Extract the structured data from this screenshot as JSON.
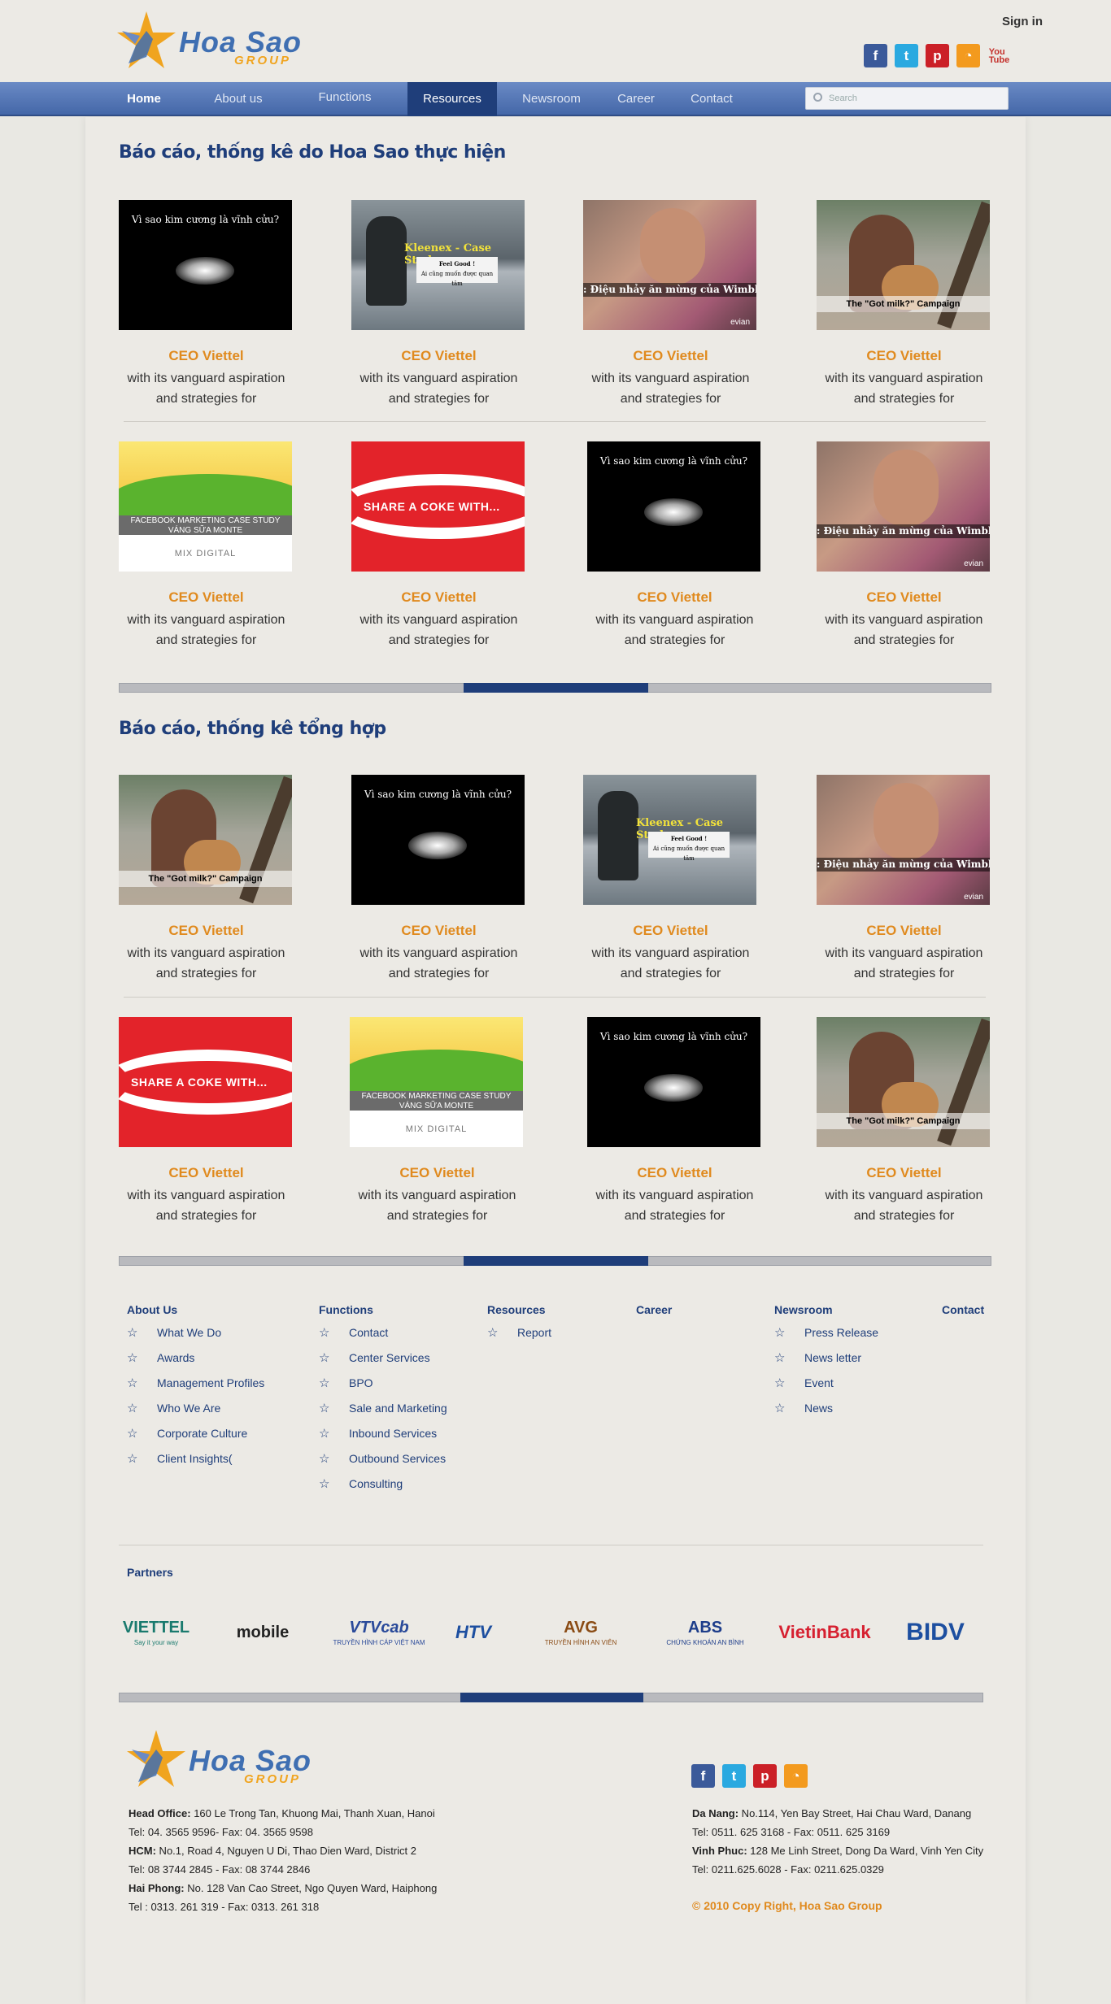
{
  "header": {
    "logo_text": "Hoa Sao",
    "logo_sub": "GROUP",
    "signin": "Sign in",
    "socials": [
      "facebook-icon",
      "twitter-icon",
      "pinterest-icon",
      "rss-icon",
      "youtube-icon"
    ]
  },
  "nav": {
    "items": [
      "Home",
      "About us",
      "Functions",
      "Resources",
      "Newsroom",
      "Career",
      "Contact"
    ],
    "active": "Resources",
    "search_placeholder": "Search"
  },
  "section1": {
    "title": "Báo cáo, thống kê do Hoa Sao thực hiện",
    "cards": [
      {
        "thumb": "diamond",
        "title": "CEO Viettel",
        "desc1": "with its vanguard aspiration",
        "desc2": "and strategies for"
      },
      {
        "thumb": "rain",
        "title": "CEO Viettel",
        "desc1": "with its vanguard aspiration",
        "desc2": "and strategies for"
      },
      {
        "thumb": "girl",
        "title": "CEO Viettel",
        "desc1": "with its vanguard aspiration",
        "desc2": "and strategies for"
      },
      {
        "thumb": "milk",
        "title": "CEO Viettel",
        "desc1": "with its vanguard aspiration",
        "desc2": "and strategies for"
      },
      {
        "thumb": "fb",
        "title": "CEO Viettel",
        "desc1": "with its vanguard aspiration",
        "desc2": "and strategies for"
      },
      {
        "thumb": "coke",
        "title": "CEO Viettel",
        "desc1": "with its vanguard aspiration",
        "desc2": "and strategies for"
      },
      {
        "thumb": "diamond",
        "title": "CEO Viettel",
        "desc1": "with its vanguard aspiration",
        "desc2": "and strategies for"
      },
      {
        "thumb": "girl",
        "title": "CEO Viettel",
        "desc1": "with its vanguard aspiration",
        "desc2": "and strategies for"
      }
    ]
  },
  "section2": {
    "title": "Báo cáo, thống kê tổng hợp",
    "cards": [
      {
        "thumb": "milk",
        "title": "CEO Viettel",
        "desc1": "with its vanguard aspiration",
        "desc2": "and strategies for"
      },
      {
        "thumb": "diamond",
        "title": "CEO Viettel",
        "desc1": "with its vanguard aspiration",
        "desc2": "and strategies for"
      },
      {
        "thumb": "rain",
        "title": "CEO Viettel",
        "desc1": "with its vanguard aspiration",
        "desc2": "and strategies for"
      },
      {
        "thumb": "girl",
        "title": "CEO Viettel",
        "desc1": "with its vanguard aspiration",
        "desc2": "and strategies for"
      },
      {
        "thumb": "coke",
        "title": "CEO Viettel",
        "desc1": "with its vanguard aspiration",
        "desc2": "and strategies for"
      },
      {
        "thumb": "fb",
        "title": "CEO Viettel",
        "desc1": "with its vanguard aspiration",
        "desc2": "and strategies for"
      },
      {
        "thumb": "diamond",
        "title": "CEO Viettel",
        "desc1": "with its vanguard aspiration",
        "desc2": "and strategies for"
      },
      {
        "thumb": "milk",
        "title": "CEO Viettel",
        "desc1": "with its vanguard aspiration",
        "desc2": "and strategies for"
      }
    ]
  },
  "thumb_text": {
    "diamond": "Vì sao kim cương là vĩnh cửu?",
    "rain_title": "Kleenex - Case Study",
    "rain_box1": "Feel Good !",
    "rain_box2": "Ai cũng muốn được quan tâm",
    "girl": ": Điệu nhảy ăn mừng của Wimbledon",
    "girl_brand": "evian",
    "milk": "The \"Got milk?\" Campaign",
    "coke": "SHARE  A COKE WITH...",
    "fb_line1": "FACEBOOK MARKETING CASE STUDY",
    "fb_line2": "VÁNG SỮA MONTE",
    "fb_brand": "MIX DIGITAL"
  },
  "progress": {
    "fill_fraction_start": 0.395,
    "fill_fraction_width": 0.212
  },
  "footer": {
    "columns": [
      {
        "title": "About Us",
        "links": [
          "What We Do",
          "Awards",
          "Management Profiles",
          "Who We Are",
          "Corporate Culture",
          "Client Insights("
        ]
      },
      {
        "title": "Functions",
        "links": [
          "Contact",
          "Center Services",
          "BPO",
          "Sale and Marketing",
          "Inbound Services",
          "Outbound Services",
          "Consulting"
        ]
      },
      {
        "title": "Resources",
        "links": [
          "Report"
        ]
      },
      {
        "title": "Career",
        "links": []
      },
      {
        "title": "Newsroom",
        "links": [
          "Press Release",
          "News letter",
          "Event",
          "News"
        ]
      },
      {
        "title": "Contact",
        "links": []
      }
    ],
    "partners_title": "Partners",
    "partners": [
      {
        "name": "VIETTEL",
        "tag": "Say it your way",
        "color": "#1a7a6e"
      },
      {
        "name": "mobile",
        "color": "#222"
      },
      {
        "name": "VTVcab",
        "tag": "TRUYỀN HÌNH CÁP VIỆT NAM",
        "color": "#2a4a9a"
      },
      {
        "name": "HTV",
        "color": "#1d4fa0"
      },
      {
        "name": "AVG",
        "tag": "TRUYỀN HÌNH AN VIÊN",
        "color": "#8a4b14"
      },
      {
        "name": "ABS",
        "tag": "CHỨNG KHOÁN AN BÌNH",
        "color": "#1d3d8a"
      },
      {
        "name": "VietinBank",
        "color": "#d62030"
      },
      {
        "name": "BIDV",
        "color": "#1d4fa0"
      }
    ]
  },
  "contact": {
    "left": [
      {
        "label": "Head Office:",
        "text": " 160 Le Trong Tan,  Khuong Mai, Thanh Xuan, Hanoi"
      },
      {
        "label": "",
        "text": "Tel: 04. 3565 9596- Fax: 04. 3565 9598"
      },
      {
        "label": "HCM:",
        "text": " No.1, Road 4, Nguyen U Di, Thao Dien Ward, District 2"
      },
      {
        "label": "",
        "text": "Tel: 08 3744 2845 - Fax: 08 3744 2846"
      },
      {
        "label": "Hai Phong:",
        "text": " No. 128 Van Cao Street, Ngo Quyen Ward, Haiphong"
      },
      {
        "label": "",
        "text": "Tel : 0313. 261 319 - Fax: 0313. 261 318"
      }
    ],
    "right": [
      {
        "label": "Da Nang:",
        "text": " No.114, Yen Bay Street, Hai Chau Ward, Danang"
      },
      {
        "label": "",
        "text": " Tel: 0511. 625 3168 - Fax: 0511. 625 3169"
      },
      {
        "label": "Vinh Phuc:",
        "text": " 128 Me Linh Street, Dong Da Ward, Vinh Yen City"
      },
      {
        "label": "",
        "text": "Tel: 0211.625.6028 - Fax: 0211.625.0329"
      }
    ],
    "copyright": "© 2010 Copy Right, Hoa Sao Group"
  },
  "colors": {
    "accent": "#e08a1e",
    "brand": "#1f3e7a",
    "nav": "#4467a8"
  }
}
